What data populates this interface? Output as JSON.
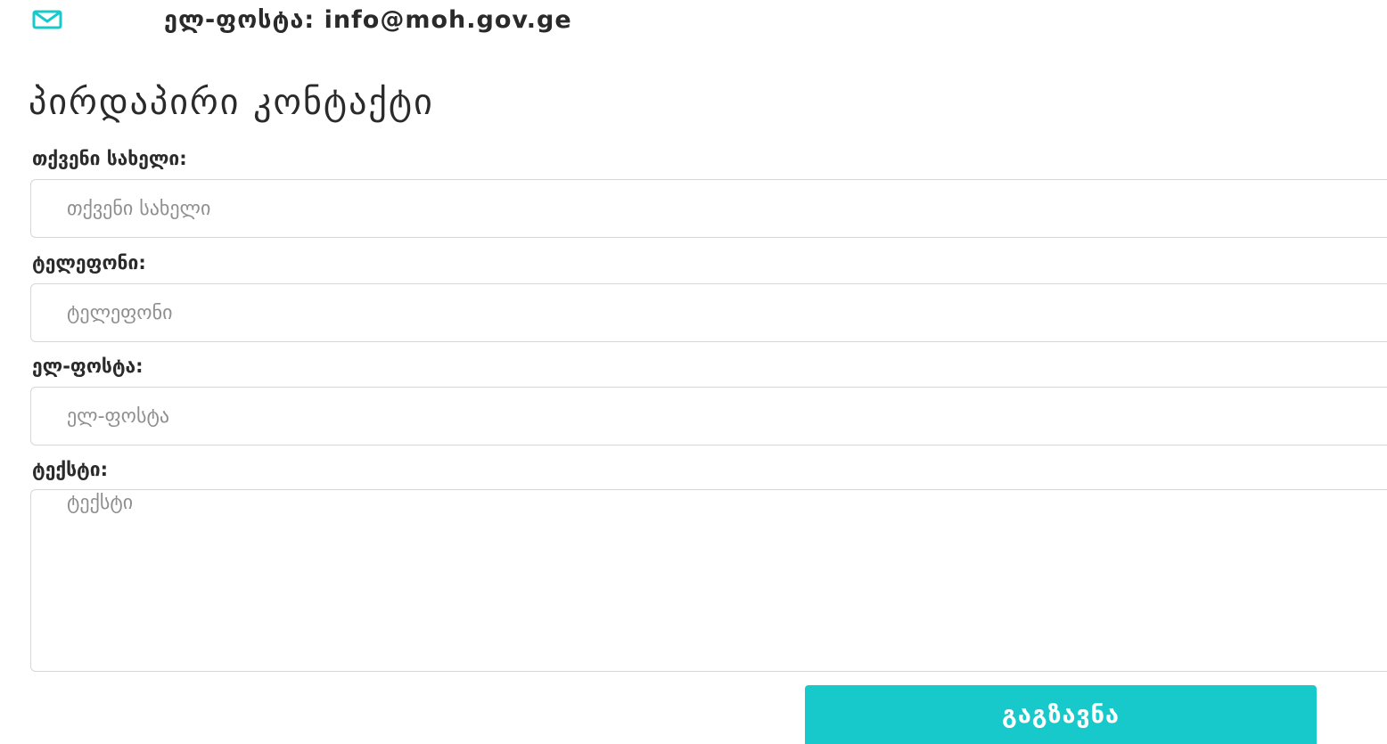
{
  "contact_info": {
    "email_text": "ელ-ფოსტა: info@moh.gov.ge",
    "email_icon": "envelope-icon",
    "icon_color": "#18c9cc"
  },
  "direct_contact": {
    "title": "პირდაპირი კონტაქტი"
  },
  "form": {
    "name_label": "თქვენი სახელი:",
    "name_placeholder": "თქვენი სახელი",
    "phone_label": "ტელეფონი:",
    "phone_placeholder": "ტელეფონი",
    "email_label": "ელ-ფოსტა:",
    "email_placeholder": "ელ-ფოსტა",
    "text_label": "ტექსტი:",
    "text_placeholder": "ტექსტი",
    "submit_label": "გაგზავნა"
  },
  "colors": {
    "accent": "#18c9cc",
    "input_border": "#d6d6d6",
    "text": "#2a2a2a",
    "placeholder": "#8f8f8f"
  }
}
